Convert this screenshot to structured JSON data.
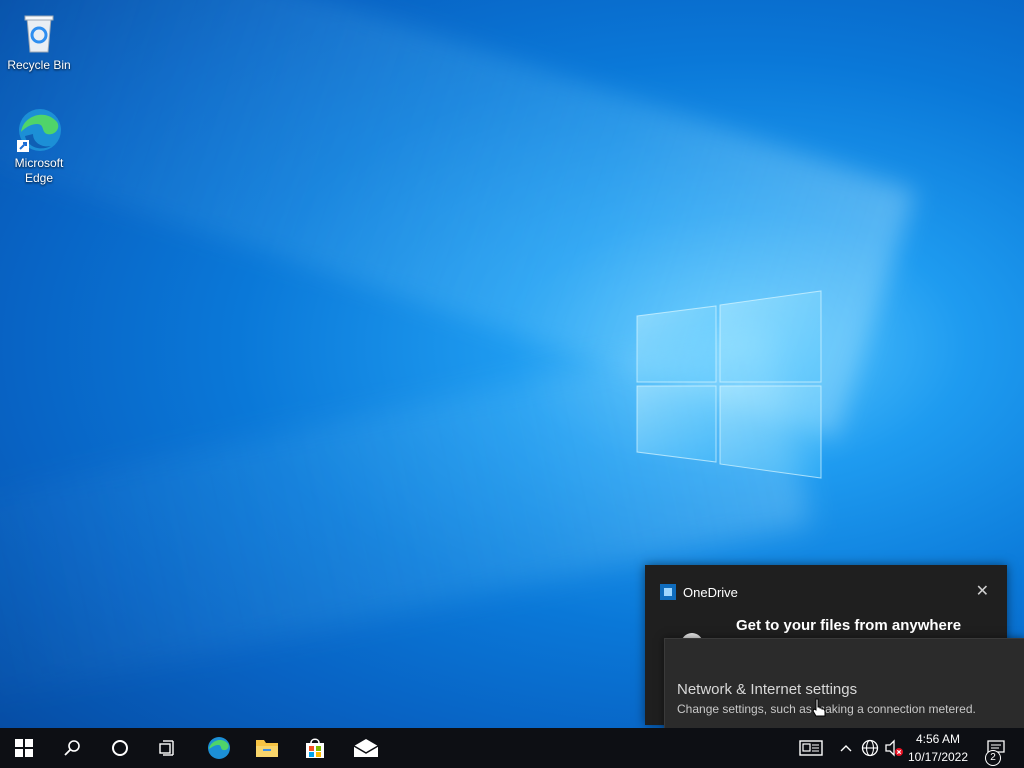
{
  "desktop": {
    "icons": [
      {
        "label": "Recycle Bin"
      },
      {
        "label": "Microsoft\nEdge"
      }
    ]
  },
  "onedrive_toast": {
    "title": "OneDrive",
    "headline": "Get to your files from anywhere",
    "close": "✕"
  },
  "tooltip": {
    "title": "Network & Internet settings",
    "description": "Change settings, such as making a connection metered."
  },
  "taskbar": {
    "time": "4:56 AM",
    "date": "10/17/2022",
    "notification_count": "2"
  }
}
